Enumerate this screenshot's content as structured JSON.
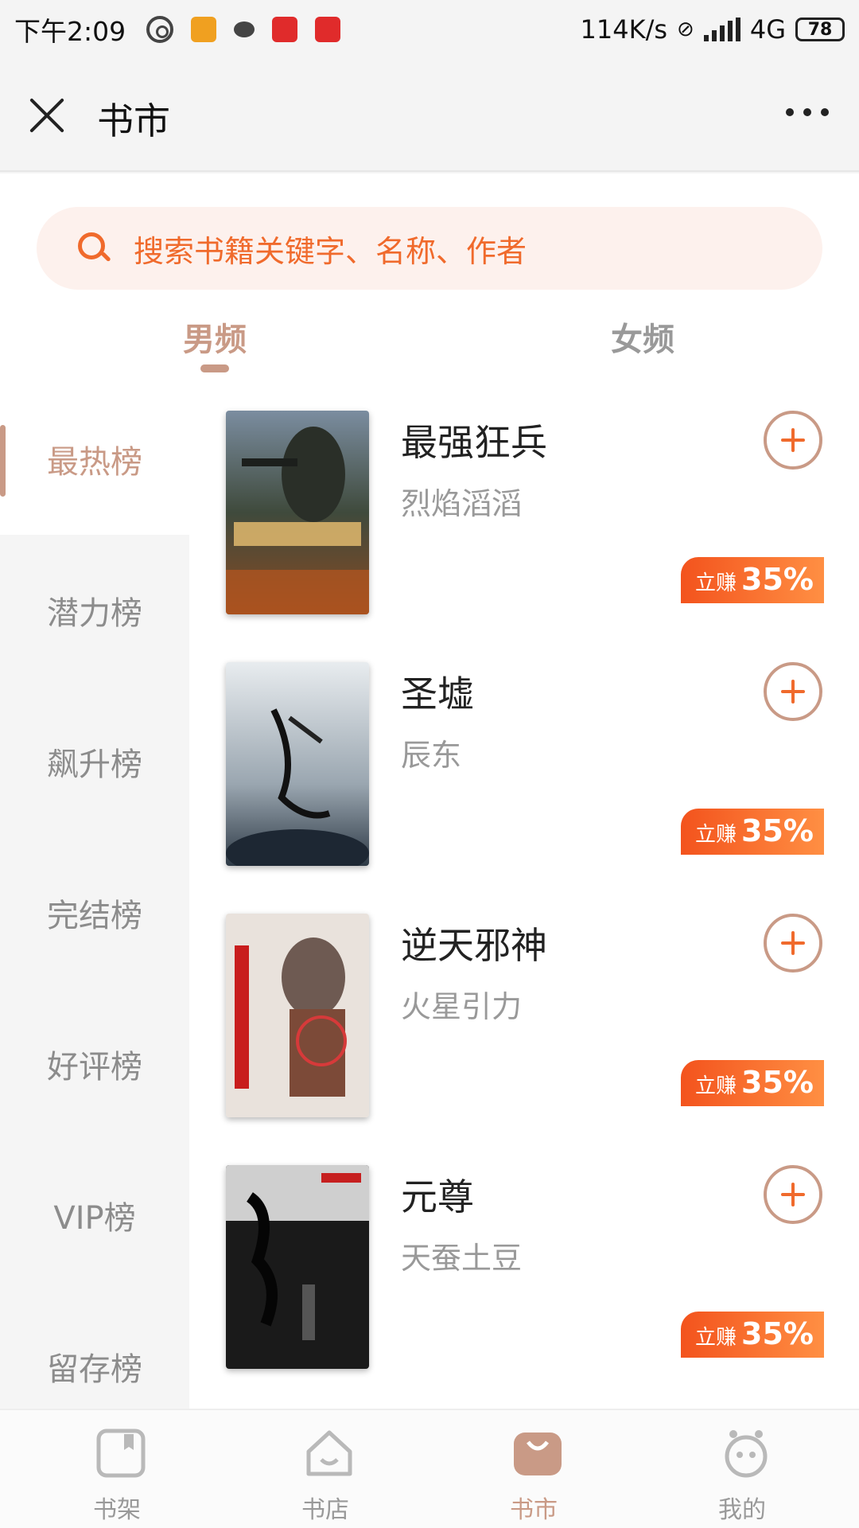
{
  "status_bar": {
    "time": "下午2:09",
    "network_speed": "114K/s",
    "network_type": "4G",
    "battery": "78"
  },
  "header": {
    "title": "书市"
  },
  "search": {
    "placeholder": "搜索书籍关键字、名称、作者"
  },
  "tabs": [
    {
      "label": "男频",
      "active": true
    },
    {
      "label": "女频",
      "active": false
    }
  ],
  "ranks": [
    {
      "label": "最热榜",
      "active": true
    },
    {
      "label": "潜力榜"
    },
    {
      "label": "飙升榜"
    },
    {
      "label": "完结榜"
    },
    {
      "label": "好评榜"
    },
    {
      "label": "VIP榜"
    },
    {
      "label": "留存榜"
    }
  ],
  "books": [
    {
      "title": "最强狂兵",
      "author": "烈焰滔滔",
      "earn_label": "立赚",
      "earn_value": "35%"
    },
    {
      "title": "圣墟",
      "author": "辰东",
      "earn_label": "立赚",
      "earn_value": "35%"
    },
    {
      "title": "逆天邪神",
      "author": "火星引力",
      "earn_label": "立赚",
      "earn_value": "35%"
    },
    {
      "title": "元尊",
      "author": "天蚕土豆",
      "earn_label": "立赚",
      "earn_value": "35%"
    }
  ],
  "bottom_nav": [
    {
      "label": "书架",
      "icon": "bookshelf-icon"
    },
    {
      "label": "书店",
      "icon": "store-home-icon"
    },
    {
      "label": "书市",
      "icon": "market-bag-icon",
      "active": true
    },
    {
      "label": "我的",
      "icon": "profile-face-icon"
    }
  ],
  "colors": {
    "accent": "#c99a86",
    "orange": "#f06a2c"
  }
}
